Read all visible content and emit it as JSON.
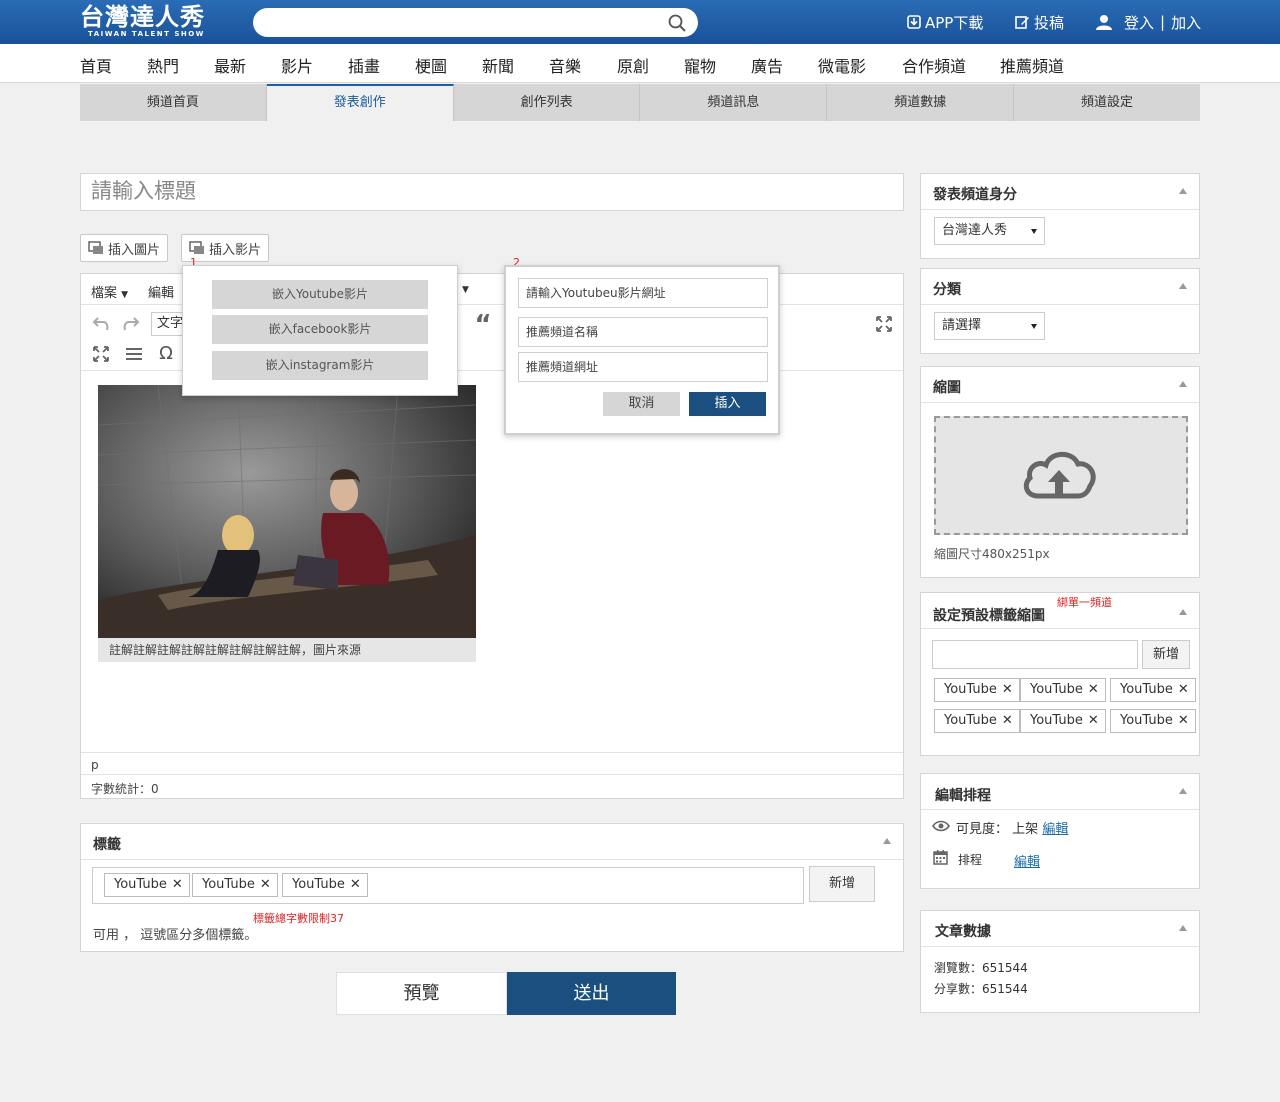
{
  "header": {
    "logo_text": "台灣達人秀",
    "logo_sub": "TAIWAN TALENT SHOW",
    "search_placeholder": "",
    "app_download": "APP下載",
    "submit_post": "投稿",
    "login": "登入",
    "separator": "|",
    "join": "加入"
  },
  "nav": [
    "首頁",
    "熱門",
    "最新",
    "影片",
    "插畫",
    "梗圖",
    "新聞",
    "音樂",
    "原創",
    "寵物",
    "廣告",
    "微電影",
    "合作頻道",
    "推薦頻道"
  ],
  "tabs": [
    {
      "label": "頻道首頁",
      "active": false
    },
    {
      "label": "發表創作",
      "active": true
    },
    {
      "label": "創作列表",
      "active": false
    },
    {
      "label": "頻道訊息",
      "active": false
    },
    {
      "label": "頻道數據",
      "active": false
    },
    {
      "label": "頻道設定",
      "active": false
    }
  ],
  "editor": {
    "title_placeholder": "請輸入標題",
    "insert_image": "插入圖片",
    "insert_video": "插入影片",
    "menu_file": "檔案",
    "menu_edit": "編輯",
    "format_value": "文字",
    "caption": "註解註解註解註解註解註解註解註解，圖片來源",
    "path": "p",
    "word_count": "字數統計：0"
  },
  "popup1": {
    "number": "1",
    "embed_youtube": "嵌入Youtube影片",
    "embed_facebook": "嵌入facebook影片",
    "embed_instagram": "嵌入instagram影片"
  },
  "popup2": {
    "number": "2",
    "url_placeholder": "請輸入Youtubeu影片網址",
    "channel_name_placeholder": "推薦頻道名稱",
    "channel_url_placeholder": "推薦頻道網址",
    "cancel": "取消",
    "insert": "插入"
  },
  "tags": {
    "title": "標籤",
    "items": [
      "YouTube",
      "YouTube",
      "YouTube"
    ],
    "add": "新增",
    "limit_note": "標籤總字數限制37",
    "hint": "可用 ， 逗號區分多個標籤。"
  },
  "actions": {
    "preview": "預覽",
    "submit": "送出"
  },
  "sidebar": {
    "identity": {
      "title": "發表頻道身分",
      "value": "台灣達人秀"
    },
    "category": {
      "title": "分類",
      "value": "請選擇"
    },
    "thumbnail": {
      "title": "縮圖",
      "size_note": "縮圖尺寸480x251px"
    },
    "default_tag_thumb": {
      "title": "設定預設標籤縮圖",
      "note": "綁單一頻道",
      "add": "新增",
      "items": [
        "YouTube",
        "YouTube",
        "YouTube",
        "YouTube",
        "YouTube",
        "YouTube"
      ]
    },
    "schedule": {
      "title": "編輯排程",
      "visibility_label": "可見度：",
      "visibility_value": "上架",
      "edit": "編輯",
      "schedule_label": "排程",
      "schedule_edit": "編輯"
    },
    "stats": {
      "title": "文章數據",
      "views": "瀏覽數：651544",
      "shares": "分享數：651544"
    }
  },
  "colors": {
    "brand_blue": "#1d5ea8",
    "submit_blue": "#1b4f7f",
    "note_red": "#dd2222"
  }
}
